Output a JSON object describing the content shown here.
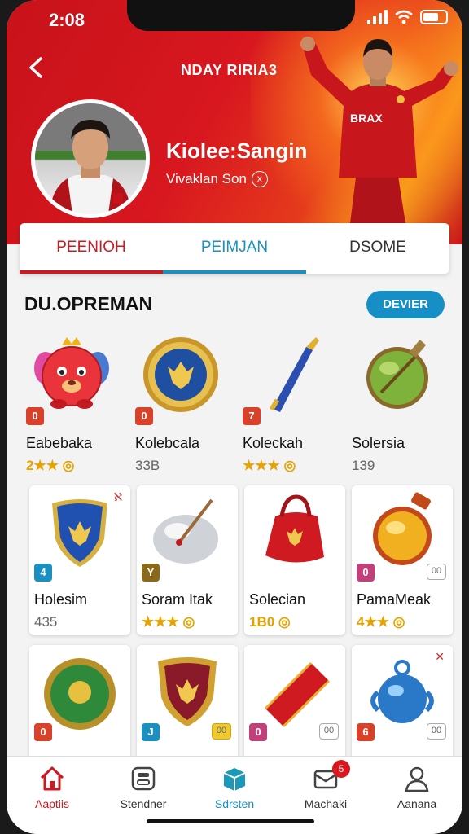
{
  "status_bar": {
    "time": "2:08"
  },
  "header": {
    "title": "NDAY RIRIA3",
    "player_name": "Kiolee:Sangin",
    "player_subtitle": "Vivaklan Son",
    "subtitle_badge": "x"
  },
  "tabs": [
    {
      "label": "PEENIOH",
      "state": "selected",
      "color": "#cc1a22"
    },
    {
      "label": "PEIMJAN",
      "state": "active",
      "color": "#1a8fc0"
    },
    {
      "label": "DSOME",
      "state": "normal",
      "color": "#333333"
    }
  ],
  "section": {
    "title": "DU.OPREMAN",
    "button_label": "DEVIER"
  },
  "items": [
    {
      "name": "Eabebaka",
      "rating": "2★★ ◎",
      "level": "0",
      "level_color": "#d8412a",
      "icon": "mascot-icon"
    },
    {
      "name": "Kolebcala",
      "rating": "33B",
      "level": "0",
      "level_color": "#d8412a",
      "icon": "medal-icon"
    },
    {
      "name": "Koleckah",
      "rating": "★★★ ◎",
      "level": "7",
      "level_color": "#d8412a",
      "icon": "sword-icon"
    },
    {
      "name": "Solersia",
      "rating": "139",
      "level": "",
      "level_color": "",
      "icon": "green-amulet-icon"
    },
    {
      "name": "Holesim",
      "rating": "435",
      "level": "4",
      "level_color": "#1a8fc0",
      "right_level": "",
      "icon": "blue-shield-icon",
      "corner_tag": "ℵ"
    },
    {
      "name": "Soram Itak",
      "rating": "★★★ ◎",
      "level": "Y",
      "level_color": "#8a6a1a",
      "right_level": "",
      "icon": "silver-orb-icon"
    },
    {
      "name": "Solecian",
      "rating": "1B0 ◎",
      "level": "",
      "level_color": "",
      "right_level": "",
      "icon": "red-bag-icon"
    },
    {
      "name": "PamaMeak",
      "rating": "4★★ ◎",
      "level": "0",
      "level_color": "#c0407a",
      "right_level": "00",
      "icon": "gold-amulet-icon"
    },
    {
      "name": "",
      "rating": "",
      "level": "0",
      "level_color": "#d8412a",
      "right_level": "",
      "icon": "green-emblem-icon"
    },
    {
      "name": "",
      "rating": "",
      "level": "J",
      "level_color": "#1a8fc0",
      "right_level": "00",
      "icon": "crest-shield-icon"
    },
    {
      "name": "",
      "rating": "",
      "level": "0",
      "level_color": "#c0407a",
      "right_level": "00",
      "icon": "red-banner-icon"
    },
    {
      "name": "",
      "rating": "",
      "level": "6",
      "level_color": "#d8412a",
      "right_level": "00",
      "icon": "blue-flask-icon",
      "corner_tag": "✕"
    }
  ],
  "bottom_nav": [
    {
      "label": "Aaptiis",
      "icon": "home-icon",
      "state": "active"
    },
    {
      "label": "Stendner",
      "icon": "grid-icon",
      "state": "normal"
    },
    {
      "label": "Sdrsten",
      "icon": "box-icon",
      "state": "teal"
    },
    {
      "label": "Machaki",
      "icon": "mail-icon",
      "state": "normal",
      "badge": "5"
    },
    {
      "label": "Aanana",
      "icon": "profile-icon",
      "state": "normal"
    }
  ]
}
